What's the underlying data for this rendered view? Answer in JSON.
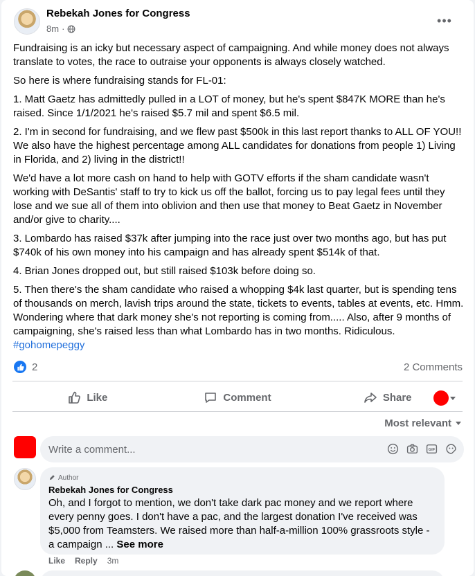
{
  "post": {
    "author": "Rebekah Jones for Congress",
    "time": "8m",
    "separator": "·",
    "more_label": "•••",
    "paragraphs": [
      "Fundraising is an icky but necessary aspect of campaigning. And while money does not always translate to votes, the race to outraise your opponents is always closely watched.",
      "So here is where fundraising stands for FL-01:",
      "1. Matt Gaetz has admittedly pulled in a LOT of money, but he's spent $847K MORE than he's raised. Since 1/1/2021 he's raised $5.7 mil and spent $6.5 mil.",
      "2. I'm in second for fundraising, and we flew past $500k in this last report thanks to ALL OF YOU!! We also have the highest percentage among ALL candidates for donations from people 1) Living in Florida, and 2) living in the district!!",
      "We'd have a lot more cash on hand to help with GOTV efforts if the sham candidate wasn't working with DeSantis' staff to try to kick us off the ballot, forcing us to pay legal fees until they lose and we sue all of them into oblivion and then use that money to Beat Gaetz in November and/or give to charity....",
      "3. Lombardo has raised $37k after jumping into the race just over two months ago, but has put $740k of his own money into his campaign and has already spent $514k of that.",
      "4. Brian Jones dropped out, but still raised $103k before doing so.",
      "5. Then there's the sham candidate who raised a whopping $4k last quarter, but is spending tens of thousands on merch, lavish trips around the state, tickets to events, tables at events, etc. Hmm. Wondering where that dark money she's not reporting is coming from..... Also, after 9 months of campaigning, she's  raised less than what Lombardo has in two months. Ridiculous."
    ],
    "hashtag": "#gohomepeggy",
    "reaction_count": "2",
    "comments_count": "2 Comments"
  },
  "actions": {
    "like": "Like",
    "comment": "Comment",
    "share": "Share"
  },
  "sort_label": "Most relevant",
  "composer": {
    "placeholder": "Write a comment..."
  },
  "comment": {
    "badge": "Author",
    "name": "Rebekah Jones for Congress",
    "text": "Oh, and I forgot to mention, we don't take dark pac money and we report where every penny goes. I don't have a pac, and the largest donation I've received was $5,000 from Teamsters. We raised more than half-a-million 100% grassroots style - a campaign ...",
    "see_more": "See more",
    "like": "Like",
    "reply": "Reply",
    "time": "3m"
  },
  "colors": {
    "brand_blue": "#1877f2",
    "link_blue": "#216fdb",
    "secondary_text": "#65676b",
    "redaction": "#ff0000"
  }
}
